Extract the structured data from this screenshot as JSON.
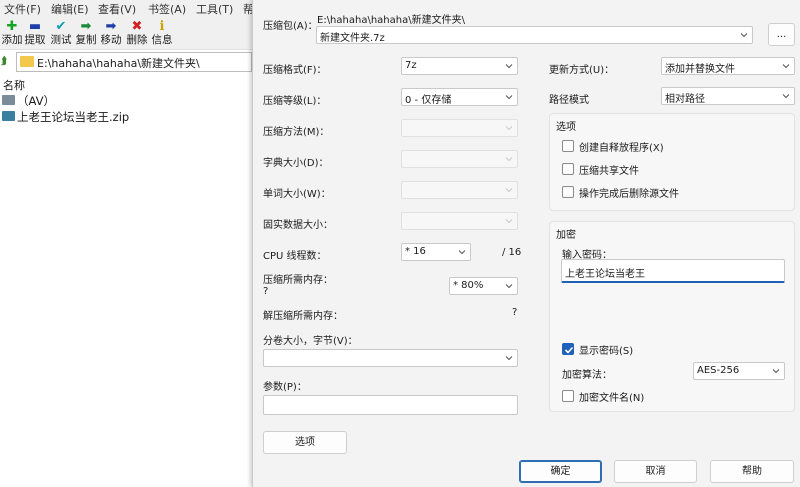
{
  "file_manager": {
    "menu": [
      "文件(F)",
      "编辑(E)",
      "查看(V)",
      "书签(A)",
      "工具(T)",
      "帮"
    ],
    "toolbar": [
      {
        "label": "添加",
        "icon": "plus-icon",
        "color": "#16a326"
      },
      {
        "label": "提取",
        "icon": "minus-icon",
        "color": "#1f3fa8"
      },
      {
        "label": "测试",
        "icon": "check-icon",
        "color": "#0b9fb0"
      },
      {
        "label": "复制",
        "icon": "copy-arrow-icon",
        "color": "#1a8a3a"
      },
      {
        "label": "移动",
        "icon": "move-arrow-icon",
        "color": "#1f3fa8"
      },
      {
        "label": "删除",
        "icon": "delete-x-icon",
        "color": "#d22020"
      },
      {
        "label": "信息",
        "icon": "info-icon",
        "color": "#c9a100"
      }
    ],
    "path": "E:\\hahaha\\hahaha\\新建文件夹\\",
    "column_name": "名称",
    "items": [
      {
        "name": "（AV）",
        "icon": "folder-icon",
        "color": "#7a8c99"
      },
      {
        "name": "上老王论坛当老王.zip",
        "icon": "zip-archive-icon",
        "color": "#3a7fa0"
      }
    ]
  },
  "dialog": {
    "archive_label": "压缩包(A)：",
    "archive_path": "E:\\hahaha\\hahaha\\新建文件夹\\",
    "archive_name": "新建文件夹.7z",
    "browse_label": "...",
    "format_label": "压缩格式(F)：",
    "format_value": "7z",
    "level_label": "压缩等级(L)：",
    "level_value": "0 - 仅存储",
    "method_label": "压缩方法(M)：",
    "dict_label": "字典大小(D)：",
    "word_label": "单词大小(W)：",
    "solid_label": "固实数据大小：",
    "threads_label": "CPU 线程数：",
    "threads_value": "* 16",
    "threads_total": "/ 16",
    "mem_comp_label": "压缩所需内存：",
    "mem_comp_value": "?",
    "mem_percent": "* 80%",
    "mem_decomp_label": "解压缩所需内存：",
    "mem_decomp_value": "?",
    "split_label": "分卷大小，字节(V)：",
    "split_value": "",
    "params_label": "参数(P)：",
    "params_value": "",
    "options_button": "选项",
    "update_label": "更新方式(U)：",
    "update_value": "添加并替换文件",
    "pathmode_label": "路径模式",
    "pathmode_value": "相对路径",
    "options_group": {
      "title": "选项",
      "sfx": {
        "label": "创建自释放程序(X)",
        "checked": false
      },
      "shared": {
        "label": "压缩共享文件",
        "checked": false
      },
      "delete": {
        "label": "操作完成后删除源文件",
        "checked": false
      }
    },
    "encryption": {
      "title": "加密",
      "password_label": "输入密码：",
      "password_value": "上老王论坛当老王",
      "show_password": {
        "label": "显示密码(S)",
        "checked": true
      },
      "method_label": "加密算法：",
      "method_value": "AES-256",
      "encrypt_names": {
        "label": "加密文件名(N)",
        "checked": false
      }
    },
    "ok_button": "确定",
    "cancel_button": "取消",
    "help_button": "帮助"
  },
  "colors": {
    "accent": "#2060b8",
    "dialog_bg": "#f3f3f3"
  }
}
